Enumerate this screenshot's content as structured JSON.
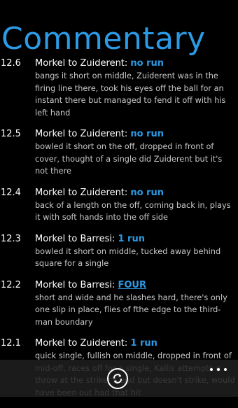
{
  "page": {
    "title": "Commentary"
  },
  "commentary": [
    {
      "over": "12.6",
      "bowler_batsman": "Morkel to Zuiderent: ",
      "result": "no run",
      "boundary": false,
      "text": "bangs it short on middle, Zuiderent was in the firing line there, took his eyes off the ball for an instant there but managed to fend it off with his left hand"
    },
    {
      "over": "12.5",
      "bowler_batsman": "Morkel to Zuiderent: ",
      "result": "no run",
      "boundary": false,
      "text": "bowled it short on the off, dropped in front of cover, thought of a single did Zuiderent but it's not there"
    },
    {
      "over": "12.4",
      "bowler_batsman": "Morkel to Zuiderent: ",
      "result": "no run",
      "boundary": false,
      "text": "back of a length on the off, coming back in, plays it with soft hands into the off side"
    },
    {
      "over": "12.3",
      "bowler_batsman": "Morkel to Barresi: ",
      "result": "1 run",
      "boundary": false,
      "text": "bowled it short on middle, tucked away behind square for a single"
    },
    {
      "over": "12.2",
      "bowler_batsman": "Morkel to Barresi: ",
      "result": "FOUR",
      "boundary": true,
      "text": "short and wide and he slashes hard, there's only one slip in place, flies of fthe edge to the third-man boundary"
    },
    {
      "over": "12.1",
      "bowler_batsman": "Morkel to Zuiderent: ",
      "result": "1 run",
      "boundary": false,
      "text": "quick single, fullish on middle, dropped in front of mid-off, races off for a single, Kallis attempts a throw at the striker's end but doesn't strike, would have been out had that hit"
    }
  ],
  "appbar": {
    "refresh_icon": "refresh-icon",
    "more_icon": "ellipsis-icon"
  }
}
